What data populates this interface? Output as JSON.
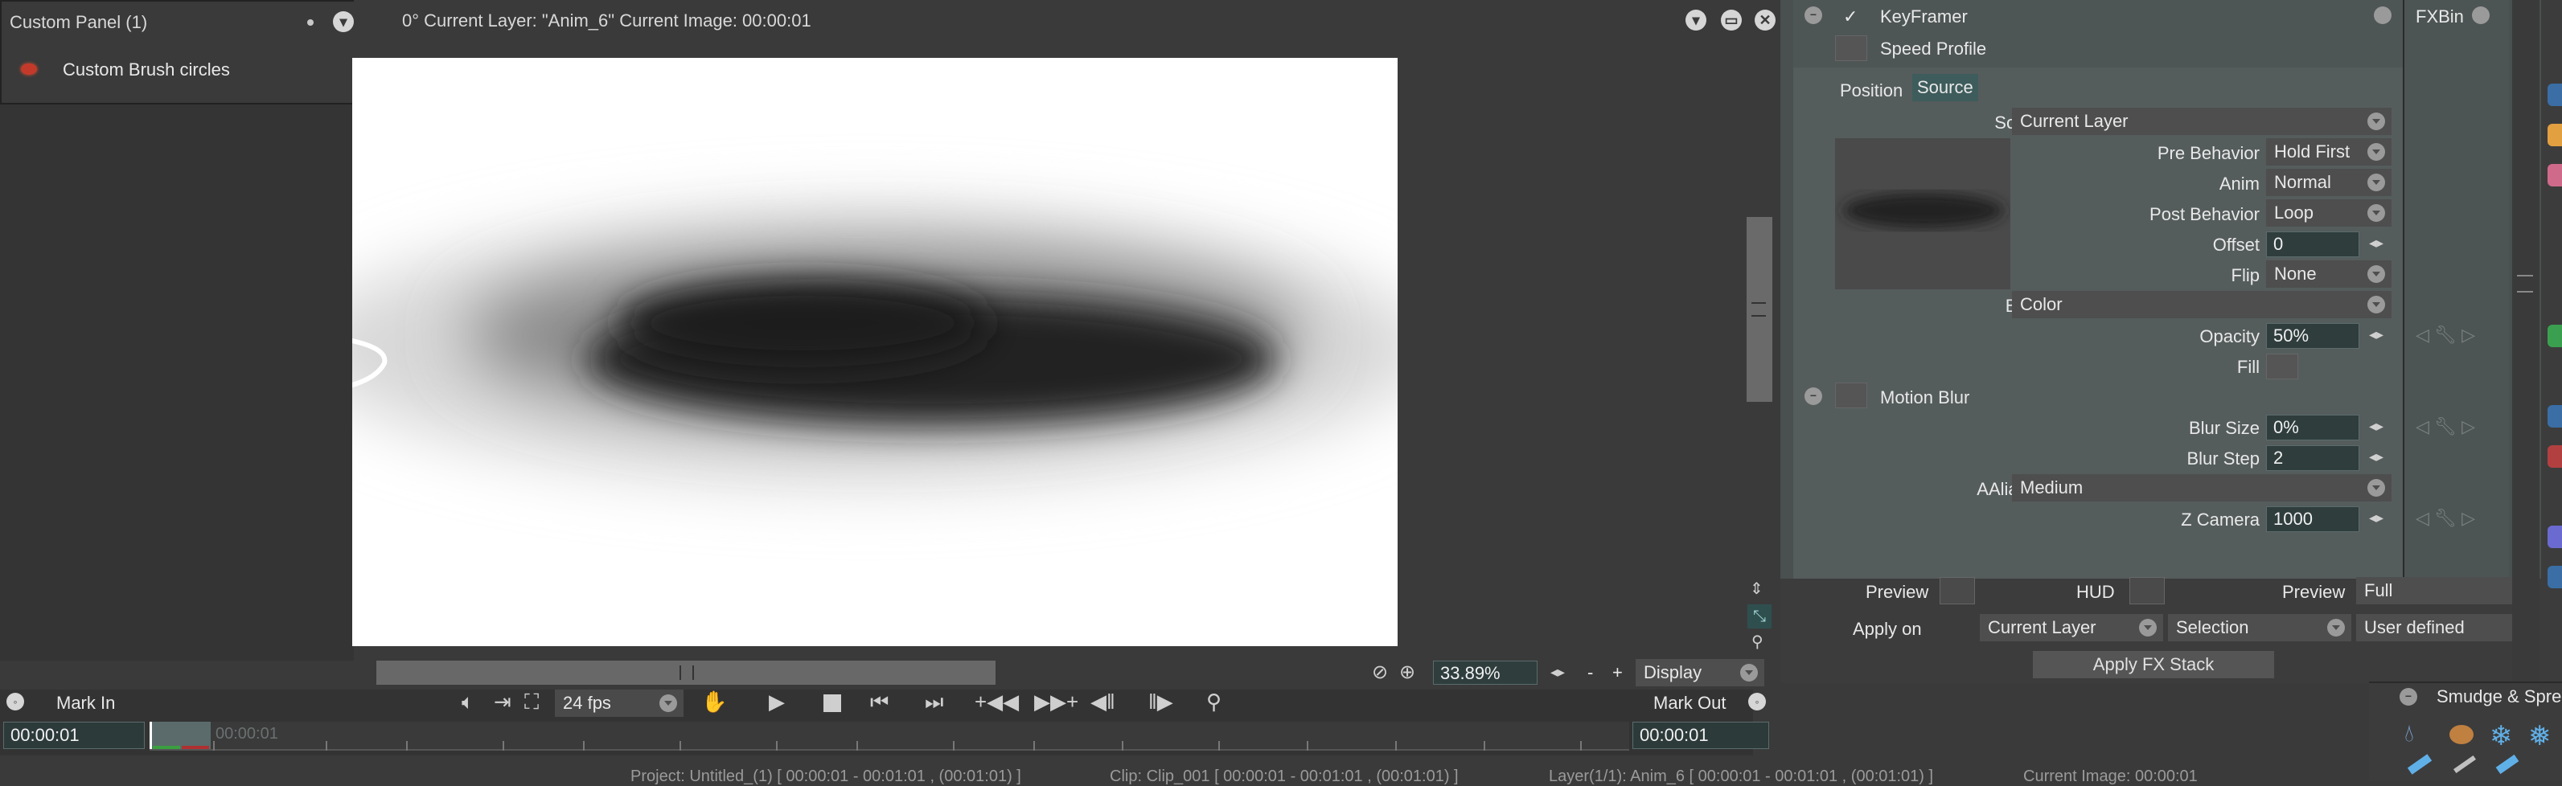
{
  "custom_panel": {
    "title": "Custom Panel (1)",
    "item_label": "Custom Brush circles"
  },
  "viewer": {
    "header": "0°  Current Layer: \"Anim_6\"  Current Image: 00:00:01",
    "zoom": "33.89%",
    "display_label": "Display",
    "minus": "-",
    "plus": "+"
  },
  "timeline": {
    "mark_in": "Mark In",
    "mark_out": "Mark Out",
    "fps": "24 fps",
    "time_left": "00:00:01",
    "time_ghost": "00:00:01",
    "time_right": "00:00:01"
  },
  "status_bar": {
    "project": "Project: Untitled_(1) [ 00:00:01 - 00:01:01 , (00:01:01) ]",
    "clip": "Clip: Clip_001 [ 00:00:01 - 00:01:01 , (00:01:01) ]",
    "layer": "Layer(1/1): Anim_6 [ 00:00:01 - 00:01:01 , (00:01:01) ]",
    "current_image": "Current Image: 00:00:01"
  },
  "fx": {
    "keyframer_label": "KeyFramer",
    "fxbin_label": "FXBin",
    "speed_profile_label": "Speed Profile",
    "tabs": [
      "Position",
      "Source"
    ],
    "source_label": "Source",
    "source_value": "Current Layer",
    "pre_behavior_label": "Pre Behavior",
    "pre_behavior_value": "Hold First",
    "anim_label": "Anim",
    "anim_value": "Normal",
    "post_behavior_label": "Post Behavior",
    "post_behavior_value": "Loop",
    "offset_label": "Offset",
    "offset_value": "0",
    "flip_label": "Flip",
    "flip_value": "None",
    "blend_label": "Blend",
    "blend_value": "Color",
    "opacity_label": "Opacity",
    "opacity_value": "50%",
    "fill_label": "Fill",
    "motion_blur_label": "Motion Blur",
    "blur_size_label": "Blur Size",
    "blur_size_value": "0%",
    "blur_step_label": "Blur Step",
    "blur_step_value": "2",
    "aaliasing_label": "AAliasing",
    "aaliasing_value": "Medium",
    "z_camera_label": "Z Camera",
    "z_camera_value": "1000",
    "preview_label": "Preview",
    "hud_label": "HUD",
    "preview2_label": "Preview",
    "preview2_value": "Full",
    "apply_on_label": "Apply on",
    "apply_on_value": "Current Layer",
    "selection_value": "Selection",
    "user_defined_value": "User defined",
    "apply_fx_stack_label": "Apply FX Stack"
  },
  "smudge_panel": {
    "title": "Smudge & Spre"
  }
}
